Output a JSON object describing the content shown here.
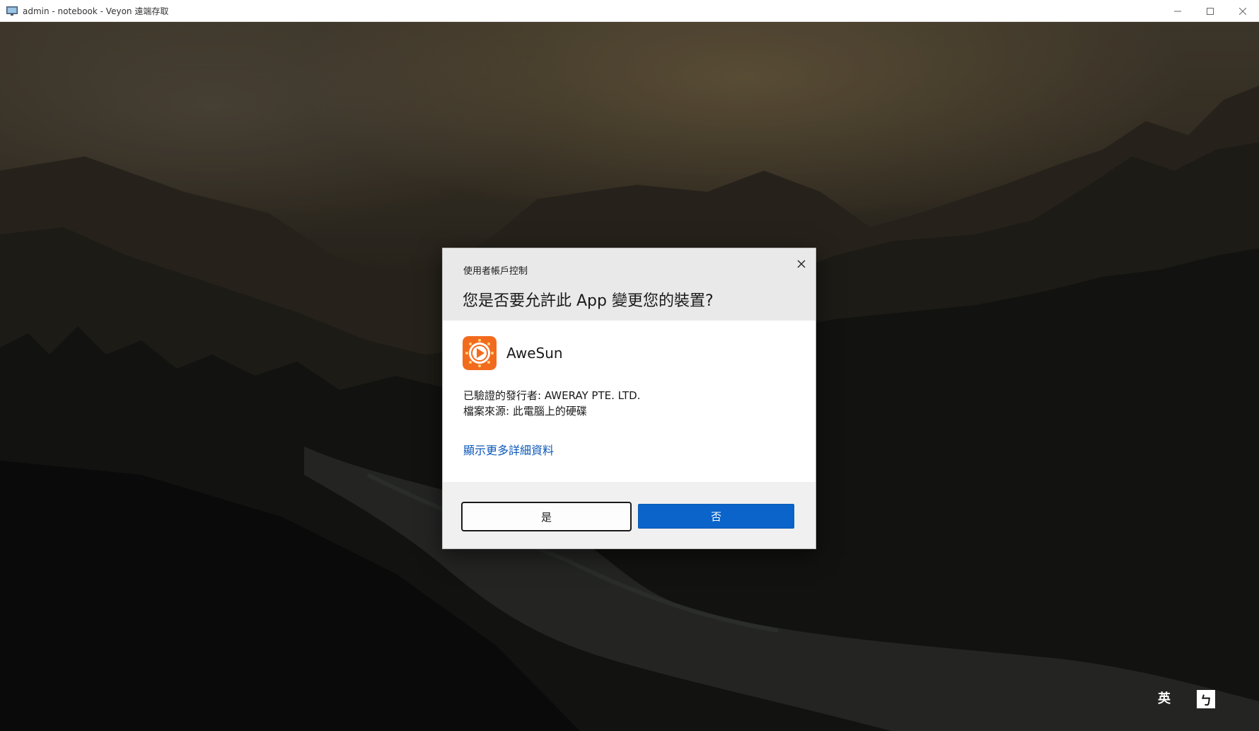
{
  "window": {
    "title": "admin - notebook - Veyon 遠端存取",
    "icon": "monitor-icon"
  },
  "window_controls": {
    "minimize_icon": "minimize-icon",
    "maximize_icon": "maximize-icon",
    "close_icon": "close-icon"
  },
  "uac_dialog": {
    "caption": "使用者帳戶控制",
    "question": "您是否要允許此 App 變更您的裝置?",
    "app_name": "AweSun",
    "app_icon": "awesun-logo-icon",
    "publisher": "已驗證的發行者: AWERAY PTE. LTD.",
    "file_origin": "檔案來源: 此電腦上的硬碟",
    "details_link": "顯示更多詳細資料",
    "yes_label": "是",
    "no_label": "否",
    "colors": {
      "header_bg": "#e9e9e9",
      "link": "#0b57b8",
      "primary_button": "#0a64c9",
      "app_logo_orange": "#f26b1d"
    }
  },
  "ime": {
    "language": "英",
    "mode": "ㄅ"
  }
}
